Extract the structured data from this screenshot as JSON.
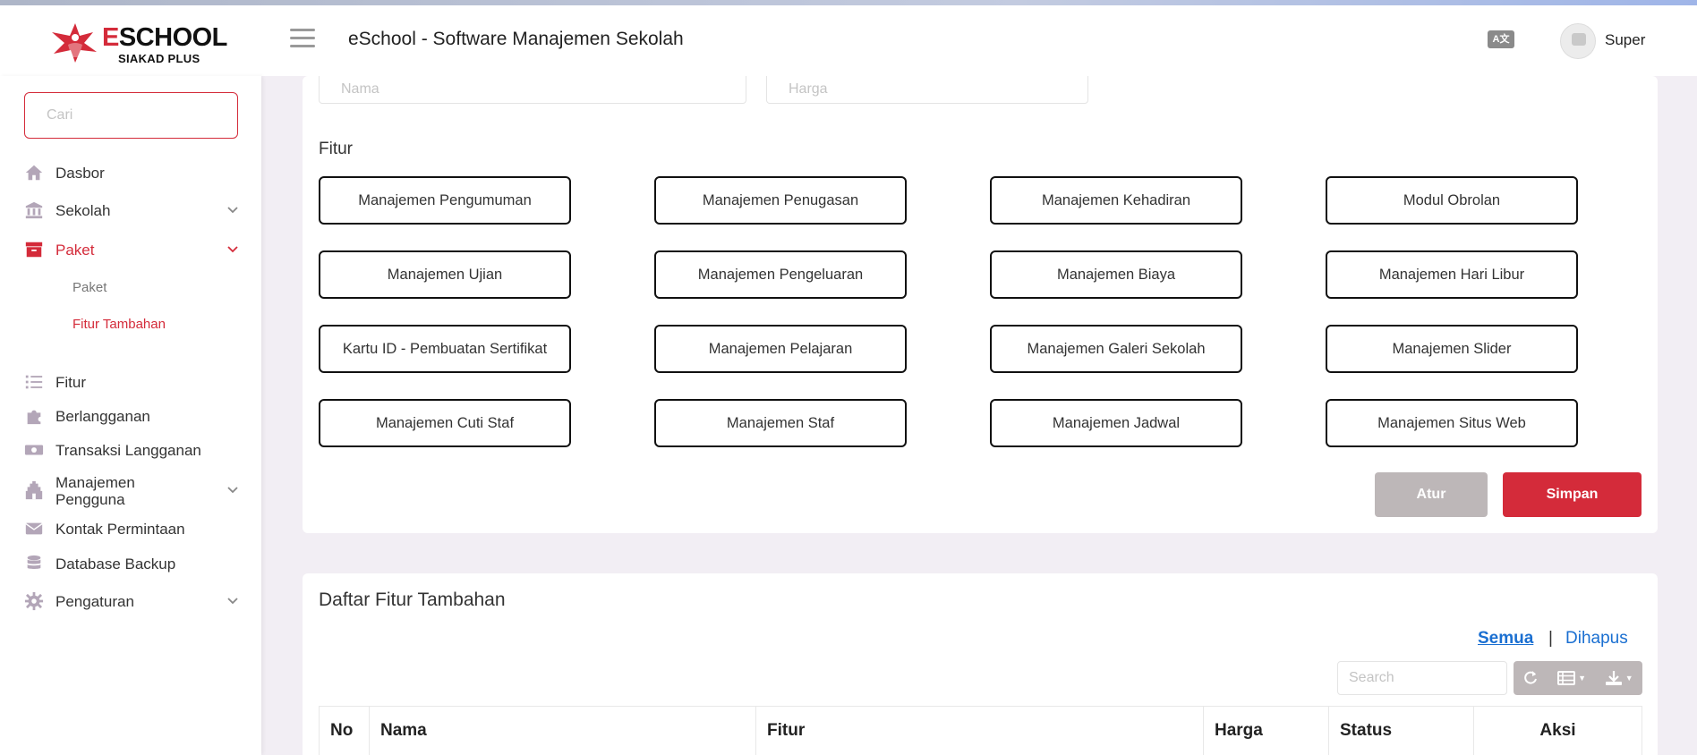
{
  "header": {
    "brand": "ESCHOOL",
    "brand_first_letter": "E",
    "brand_rest": "SCHOOL",
    "brand_sub": "SIAKAD PLUS",
    "title": "eSchool - Software Manajemen Sekolah",
    "lang_icon_text": "A文",
    "user_name": "Super"
  },
  "sidebar": {
    "search_placeholder": "Cari",
    "items": [
      {
        "label": "Dasbor",
        "icon": "home-icon"
      },
      {
        "label": "Sekolah",
        "icon": "bank-icon"
      },
      {
        "label": "Paket",
        "icon": "archive-icon"
      },
      {
        "label": "Fitur",
        "icon": "list-icon"
      },
      {
        "label": "Berlangganan",
        "icon": "puzzle-icon"
      },
      {
        "label": "Transaksi Langganan",
        "icon": "money-icon"
      },
      {
        "label": "Manajemen Pengguna",
        "label_line1": "Manajemen",
        "label_line2": "Pengguna",
        "icon": "gopuram-icon"
      },
      {
        "label": "Kontak Permintaan",
        "icon": "envelope-icon"
      },
      {
        "label": "Database Backup",
        "icon": "database-icon"
      },
      {
        "label": "Pengaturan",
        "icon": "gear-icon"
      }
    ],
    "sub_items": [
      "Paket",
      "Fitur Tambahan"
    ]
  },
  "form": {
    "name_placeholder": "Nama",
    "price_placeholder": "Harga",
    "features_label": "Fitur",
    "features": [
      "Manajemen Pengumuman",
      "Manajemen Penugasan",
      "Manajemen Kehadiran",
      "Modul Obrolan",
      "Manajemen Ujian",
      "Manajemen Pengeluaran",
      "Manajemen Biaya",
      "Manajemen Hari Libur",
      "Kartu ID - Pembuatan Sertifikat",
      "Manajemen Pelajaran",
      "Manajemen Galeri Sekolah",
      "Manajemen Slider",
      "Manajemen Cuti Staf",
      "Manajemen Staf",
      "Manajemen Jadwal",
      "Manajemen Situs Web"
    ],
    "reset_label": "Atur",
    "save_label": "Simpan"
  },
  "list": {
    "title": "Daftar Fitur Tambahan",
    "filter_all": "Semua",
    "filter_sep": "|",
    "filter_deleted": "Dihapus",
    "search_placeholder": "Search",
    "columns": [
      "No",
      "Nama",
      "Fitur",
      "Harga",
      "Status",
      "Aksi"
    ]
  },
  "colors": {
    "accent": "#d42b3a",
    "link": "#1a6fd1",
    "muted_button": "#bdb7b8",
    "icon_muted": "#b3a6b8"
  }
}
